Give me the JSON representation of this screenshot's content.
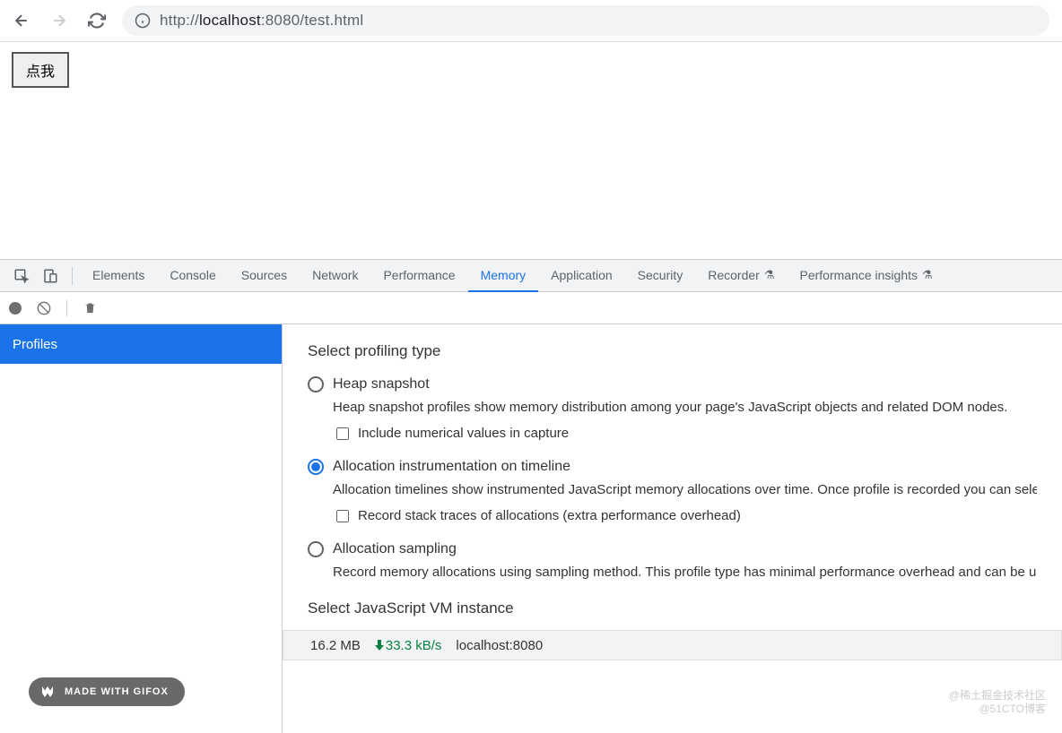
{
  "browser": {
    "url_proto": "http://",
    "url_host": "localhost",
    "url_port": ":8080",
    "url_path": "/test.html"
  },
  "page": {
    "button_label": "点我"
  },
  "devtools": {
    "tabs": {
      "elements": "Elements",
      "console": "Console",
      "sources": "Sources",
      "network": "Network",
      "performance": "Performance",
      "memory": "Memory",
      "application": "Application",
      "security": "Security",
      "recorder": "Recorder",
      "insights": "Performance insights"
    },
    "active_tab": "Memory",
    "sidebar": {
      "profiles": "Profiles"
    },
    "section_title": "Select profiling type",
    "options": {
      "heap": {
        "label": "Heap snapshot",
        "desc": "Heap snapshot profiles show memory distribution among your page's JavaScript objects and related DOM nodes.",
        "check": "Include numerical values in capture"
      },
      "timeline": {
        "label": "Allocation instrumentation on timeline",
        "desc": "Allocation timelines show instrumented JavaScript memory allocations over time. Once profile is recorded you can sele",
        "check": "Record stack traces of allocations (extra performance overhead)"
      },
      "sampling": {
        "label": "Allocation sampling",
        "desc": "Record memory allocations using sampling method. This profile type has minimal performance overhead and can be u"
      }
    },
    "vm_title": "Select JavaScript VM instance",
    "vm_row": {
      "size": "16.2 MB",
      "rate": "33.3 kB/s",
      "host": "localhost:8080"
    }
  },
  "gifox": "MADE WITH GIFOX",
  "watermark": {
    "line1": "@稀土掘金技术社区",
    "line2": "@51CTO博客"
  }
}
